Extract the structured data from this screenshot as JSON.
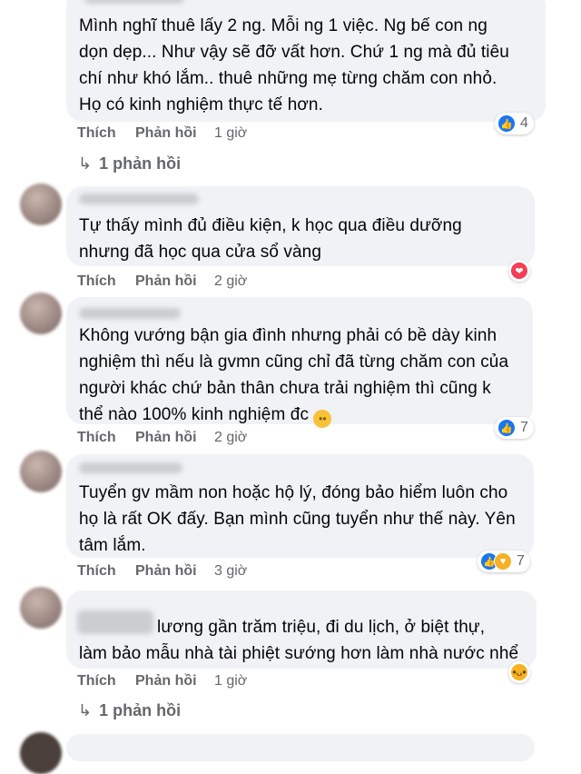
{
  "actions": {
    "like": "Thích",
    "reply": "Phản hồi"
  },
  "comments": [
    {
      "text": "Mình nghĩ thuê lấy 2 ng. Mỗi ng 1 việc. Ng bế con ng\ndọn dẹp... Như vậy sẽ đỡ vất hơn. Chứ 1 ng mà đủ tiêu\nchí như khó lắm.. thuê những mẹ từng chăm con nhỏ.\nHọ có kinh nghiệm thực tế hơn.",
      "time": "1 giờ",
      "reaction_count": "4",
      "reactions": [
        "like-reaction-icon"
      ],
      "replies": "1 phản hồi"
    },
    {
      "text": "Tự thấy mình đủ điều kiện, k học qua điều dưỡng\nnhưng đã học qua cửa sổ vàng",
      "time": "2 giờ",
      "reaction_count": "",
      "reactions": [
        "love-reaction-icon"
      ]
    },
    {
      "text": "Không vướng bận gia đình nhưng phải có bề dày kinh\nnghiệm thì nếu là gvmn cũng chỉ đã từng chăm con của\nngười khác chứ bản thân chưa trải nghiệm thì cũng k\nthể nào 100% kinh nghiệm đc",
      "time": "2 giờ",
      "reaction_count": "7",
      "reactions": [
        "like-reaction-icon"
      ]
    },
    {
      "text": "Tuyển gv mầm non hoặc hộ lý, đóng bảo hiểm luôn cho\nhọ là rất OK đấy. Bạn mình cũng tuyển như thế này. Yên\ntâm lắm.",
      "time": "3 giờ",
      "reaction_count": "7",
      "reactions": [
        "like-reaction-icon",
        "care-reaction-icon"
      ]
    },
    {
      "text_line1": "lương gần trăm triệu, đi du lịch, ở biệt thự,",
      "text_line2": "làm bảo mẫu nhà tài phiệt sướng hơn làm nhà nước nhể",
      "time": "1 giờ",
      "reaction_count": "",
      "reactions": [
        "haha-reaction-icon"
      ],
      "replies": "1 phản hồi"
    }
  ]
}
